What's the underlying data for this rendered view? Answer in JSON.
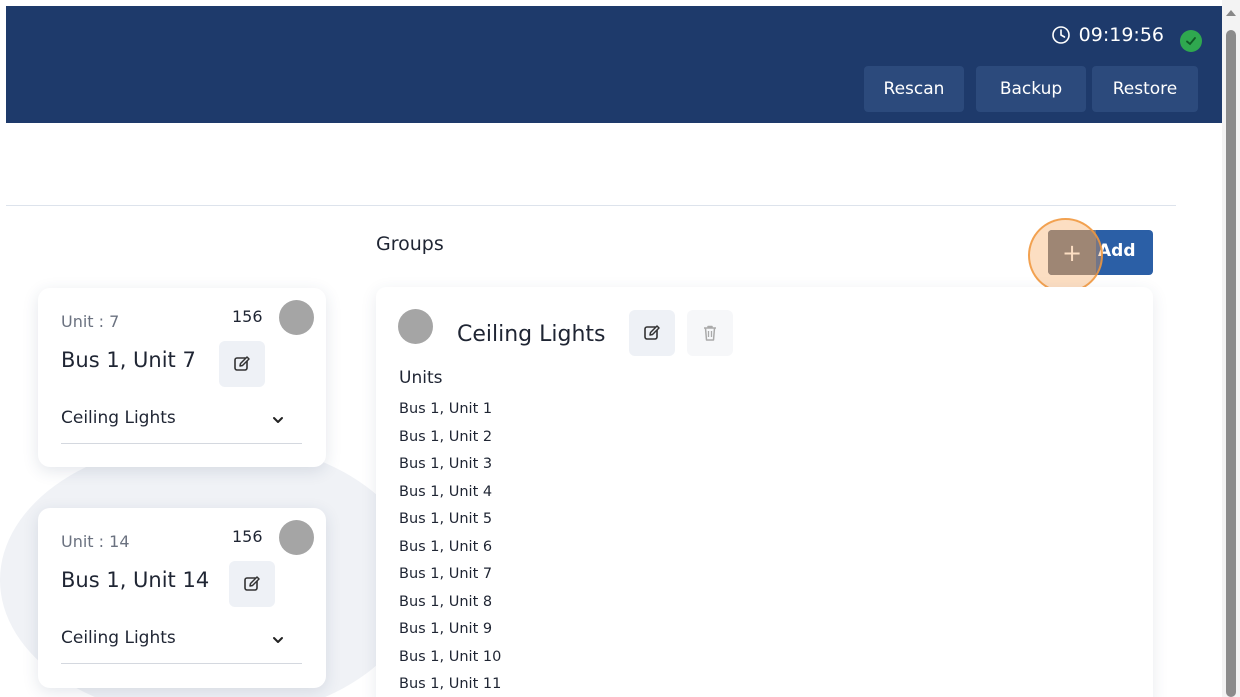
{
  "header": {
    "time": "09:19:56",
    "buttons": {
      "rescan": "Rescan",
      "backup": "Backup",
      "restore": "Restore"
    }
  },
  "unit_cards": [
    {
      "unit_label": "Unit : 7",
      "count": "156",
      "name": "Bus 1, Unit 7",
      "group": "Ceiling Lights"
    },
    {
      "unit_label": "Unit : 14",
      "count": "156",
      "name": "Bus 1, Unit 14",
      "group": "Ceiling Lights"
    }
  ],
  "groups": {
    "title": "Groups",
    "add_label": "Add",
    "add_icon": "+",
    "group": {
      "name": "Ceiling Lights",
      "units_label": "Units",
      "units": [
        "Bus 1, Unit 1",
        "Bus 1, Unit 2",
        "Bus 1, Unit 3",
        "Bus 1, Unit 4",
        "Bus 1, Unit 5",
        "Bus 1, Unit 6",
        "Bus 1, Unit 7",
        "Bus 1, Unit 8",
        "Bus 1, Unit 9",
        "Bus 1, Unit 10",
        "Bus 1, Unit 11"
      ]
    }
  },
  "colors": {
    "header": "#1e3a6b",
    "accent": "#2b5fa6",
    "status_ok": "#2fa84f",
    "indicator": "#a5a5a5"
  },
  "icons": {
    "clock": "clock-icon",
    "status": "check-circle-icon",
    "edit": "edit-icon",
    "delete": "trash-icon",
    "chevron": "chevron-down-icon",
    "add": "plus-icon"
  }
}
